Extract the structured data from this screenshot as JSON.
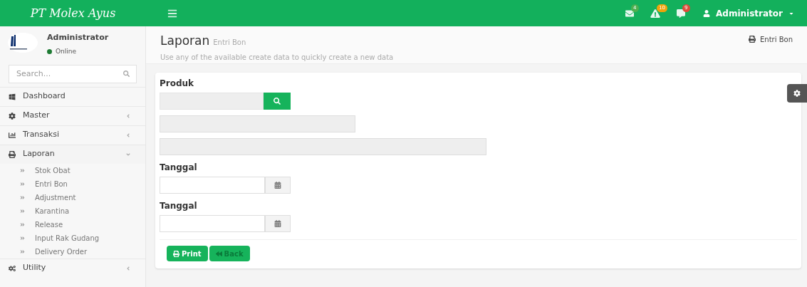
{
  "brand": "PT Molex Ayus",
  "notifications": [
    {
      "kind": "mail",
      "count": "4",
      "color": "#4caf50"
    },
    {
      "kind": "warning",
      "count": "10",
      "color": "#f0a30a"
    },
    {
      "kind": "message",
      "count": "9",
      "color": "#dd4b39"
    }
  ],
  "user_menu": "Administrator",
  "user_panel": {
    "name": "Administrator",
    "status": {
      "label": "Online",
      "color": "#1e7b34"
    }
  },
  "search": {
    "placeholder": "Search..."
  },
  "menu": [
    {
      "kind": "dashboard",
      "label": "Dashboard"
    },
    {
      "kind": "master",
      "label": "Master",
      "expanded": false
    },
    {
      "kind": "transaksi",
      "label": "Transaksi",
      "expanded": false
    },
    {
      "kind": "laporan",
      "label": "Laporan",
      "expanded": true,
      "children": [
        {
          "label": "Stok Obat",
          "selected": false
        },
        {
          "label": "Entri Bon",
          "selected": false
        },
        {
          "label": "Adjustment",
          "selected": false
        },
        {
          "label": "Karantina",
          "selected": false
        },
        {
          "label": "Release",
          "selected": false
        },
        {
          "label": "Input Rak Gudang",
          "selected": false
        },
        {
          "label": "Delivery Order",
          "selected": false
        }
      ]
    },
    {
      "kind": "utility",
      "label": "Utility",
      "expanded": false
    }
  ],
  "page": {
    "title": "Laporan",
    "subtitle": "Entri Bon",
    "description": "Use any of the available create data to quickly create a new data",
    "breadcrumb": "Entri Bon"
  },
  "form": {
    "fields": [
      {
        "kind": "lookup",
        "label": "Produk"
      },
      {
        "kind": "display"
      },
      {
        "kind": "display_wide"
      },
      {
        "kind": "date",
        "label": "Tanggal"
      },
      {
        "kind": "date",
        "label": "Tanggal"
      }
    ],
    "buttons": [
      {
        "kind": "print",
        "label": "Print"
      },
      {
        "kind": "back",
        "label": "Back"
      }
    ]
  }
}
